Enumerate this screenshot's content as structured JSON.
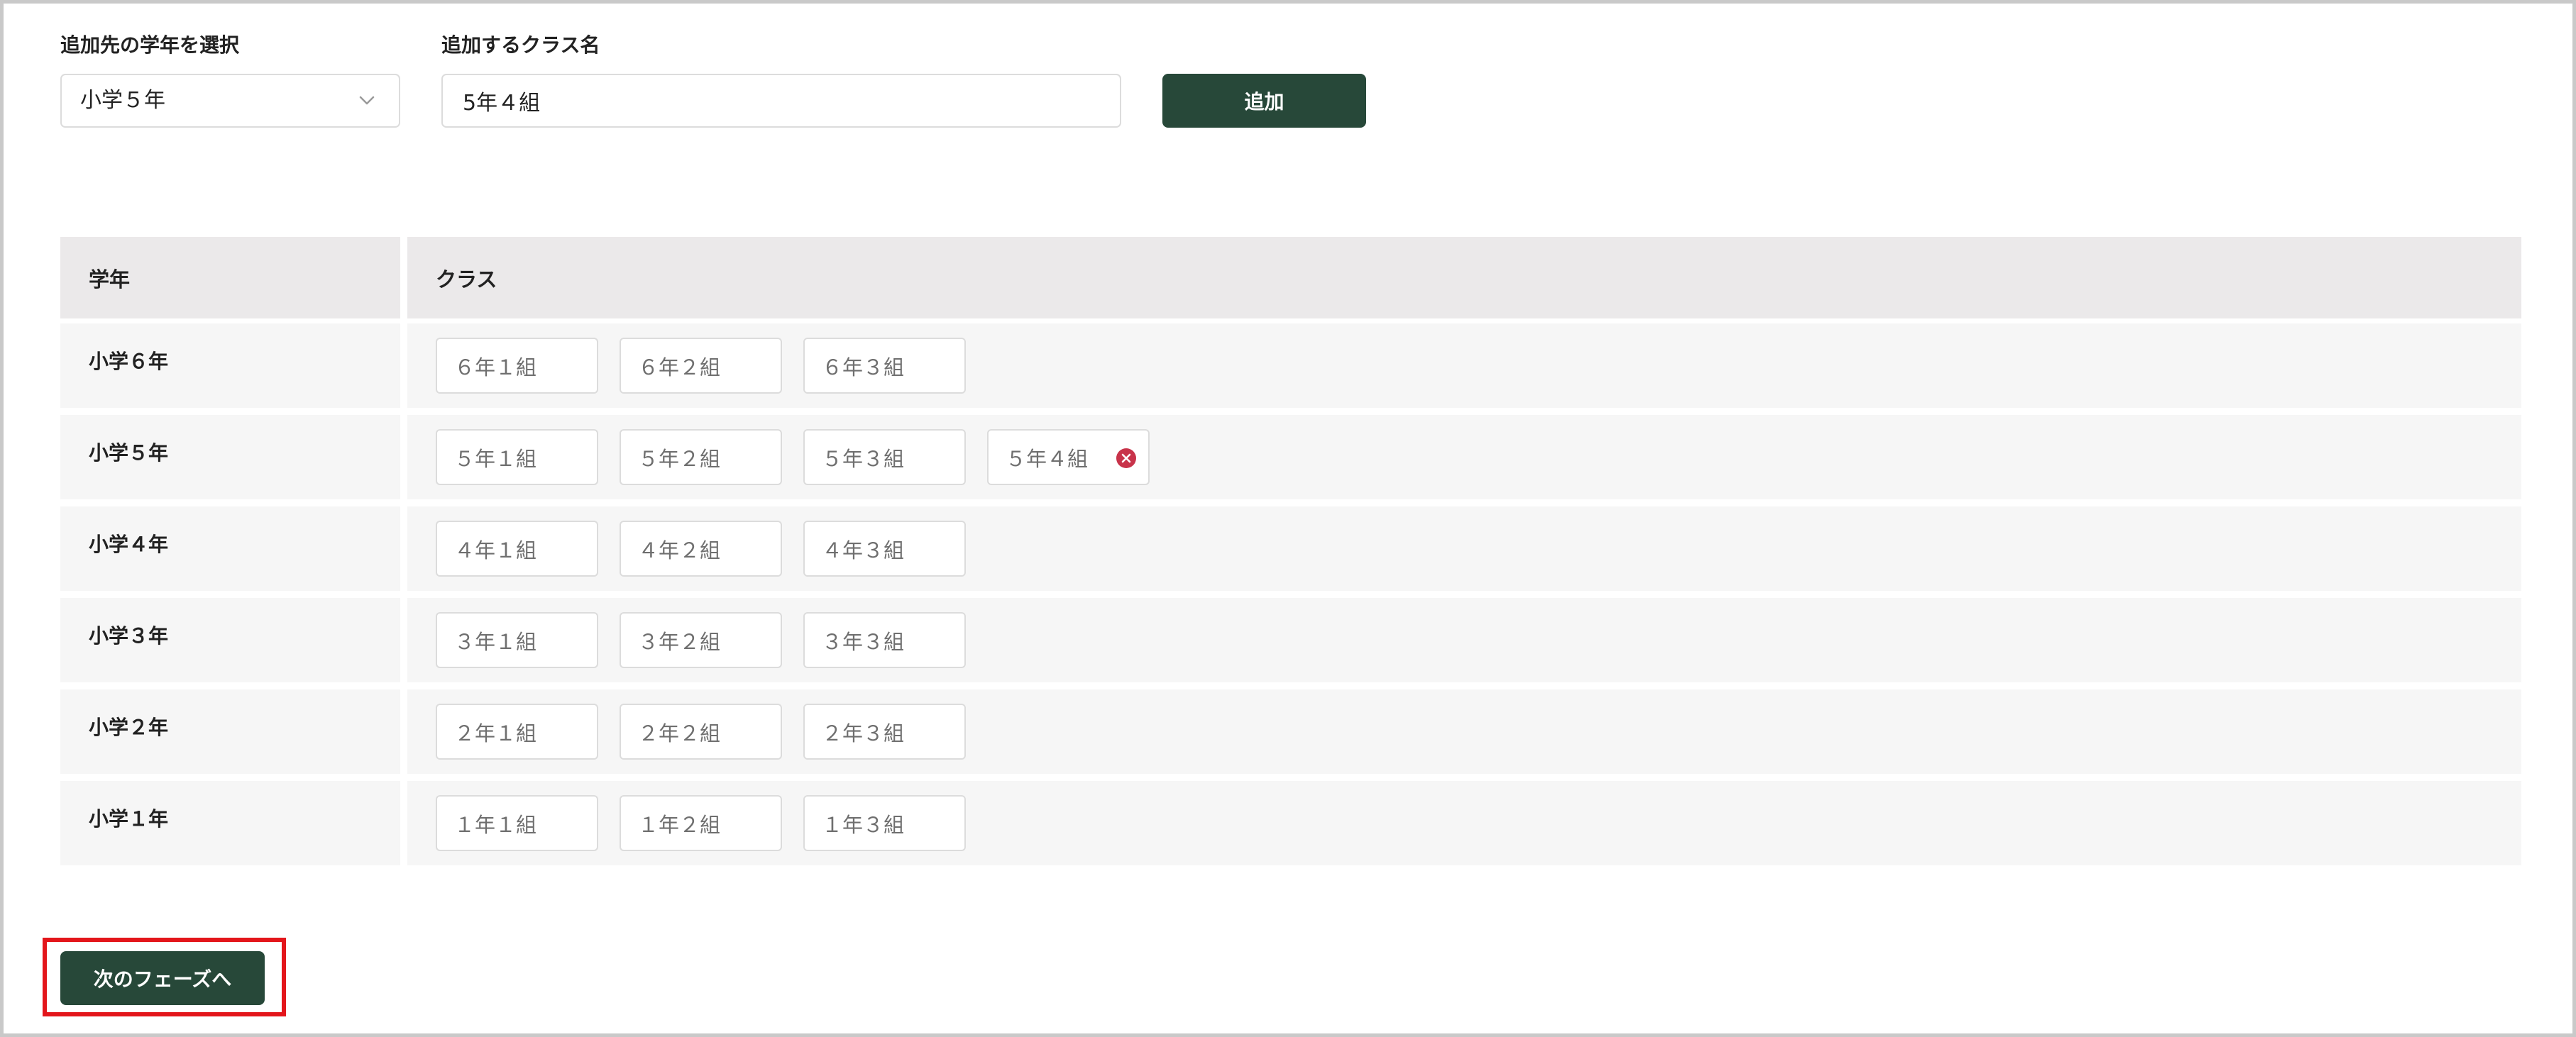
{
  "form": {
    "grade_label": "追加先の学年を選択",
    "grade_selected": "小学５年",
    "class_name_label": "追加するクラス名",
    "class_name_value": "5年４組",
    "add_button": "追加"
  },
  "table": {
    "header_grade": "学年",
    "header_classes": "クラス",
    "rows": [
      {
        "grade": "小学６年",
        "classes": [
          "６年１組",
          "６年２組",
          "６年３組"
        ]
      },
      {
        "grade": "小学５年",
        "classes": [
          "５年１組",
          "５年２組",
          "５年３組",
          "５年４組"
        ]
      },
      {
        "grade": "小学４年",
        "classes": [
          "４年１組",
          "４年２組",
          "４年３組"
        ]
      },
      {
        "grade": "小学３年",
        "classes": [
          "３年１組",
          "３年２組",
          "３年３組"
        ]
      },
      {
        "grade": "小学２年",
        "classes": [
          "２年１組",
          "２年２組",
          "２年３組"
        ]
      },
      {
        "grade": "小学１年",
        "classes": [
          "１年１組",
          "１年２組",
          "１年３組"
        ]
      }
    ]
  },
  "footer": {
    "next_button": "次のフェーズへ"
  },
  "colors": {
    "primary": "#274839",
    "remove": "#c8334a",
    "highlight": "#e3161b"
  },
  "icons": {
    "select_chevron": "chevron-down-icon",
    "chip_remove": "close-circle-icon"
  }
}
